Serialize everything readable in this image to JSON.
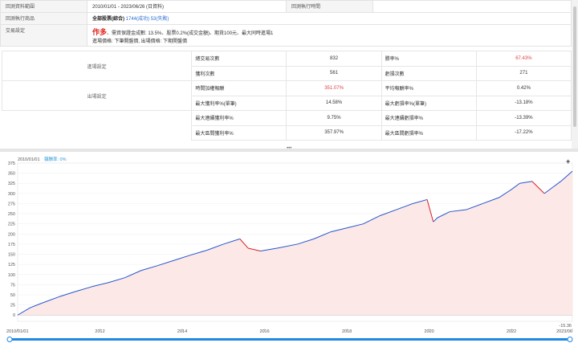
{
  "info": {
    "range_label": "回測資料範圍",
    "range_value": "2010/01/01 - 2023/06/26 (日資料)",
    "exec_time_label": "回測執行時間",
    "exec_time_value": "",
    "products_label": "回測執行商品",
    "products_prefix": "全部股票(綜合)",
    "products_success": "1744(成功)",
    "products_fail": "53(失敗)",
    "trade_label": "交易設定",
    "trade_author": "作多",
    "trade_detail": "、需資保證金成數: 13.5%、股票0.2%(成交金額)、期貨100元、最大同時進場1",
    "trade_detail2": "進場價格: 下筆開盤價, 出場價格: 下期開盤價"
  },
  "stats": {
    "entry_label": "進場設定",
    "exit_label": "出場設定",
    "rows": [
      {
        "l1": "總交易次數",
        "v1": "832",
        "l2": "勝率%",
        "v2": "67.43%",
        "v1red": false,
        "v2red": true
      },
      {
        "l1": "獲利次數",
        "v1": "561",
        "l2": "虧損次數",
        "v2": "271",
        "v1red": false,
        "v2red": false
      },
      {
        "l1": "時間加權報酬",
        "v1": "351.07%",
        "l2": "平均報酬率%",
        "v2": "0.42%",
        "v1red": true,
        "v2red": false
      },
      {
        "l1": "最大獲利率%(單筆)",
        "v1": "14.58%",
        "l2": "最大虧損率%(單筆)",
        "v2": "-13.18%",
        "v1red": false,
        "v2red": false
      },
      {
        "l1": "最大連續獲利率%",
        "v1": "9.75%",
        "l2": "最大連續虧損率%",
        "v2": "-13.39%",
        "v1red": false,
        "v2red": false
      },
      {
        "l1": "最大區間獲利率%",
        "v1": "357.97%",
        "l2": "最大區間虧損率%",
        "v2": "-17.22%",
        "v1red": false,
        "v2red": false
      }
    ]
  },
  "chart_data": {
    "type": "area",
    "title": "",
    "header_date": "2010/01/01",
    "header_metric": "報酬率: 0%",
    "ylim": [
      -15.36,
      375
    ],
    "yticks": [
      0,
      25,
      50,
      75,
      100,
      125,
      150,
      175,
      200,
      225,
      250,
      275,
      300,
      325,
      350,
      375
    ],
    "bottom_value": "-15.36",
    "xlim": [
      2010.0,
      2023.48
    ],
    "xticks": [
      "2010/01/01",
      "2012",
      "2014",
      "2016",
      "2018",
      "2020",
      "2022",
      "2023/06"
    ],
    "xtick_values": [
      2010.0,
      2012,
      2014,
      2016,
      2018,
      2020,
      2022,
      2023.48
    ],
    "series": [
      {
        "x": [
          2010.0,
          2010.3,
          2010.6,
          2011.0,
          2011.4,
          2011.8,
          2012.2,
          2012.6,
          2013.0,
          2013.4,
          2013.8,
          2014.2,
          2014.6,
          2015.0,
          2015.4,
          2015.6,
          2015.9,
          2016.3,
          2016.8,
          2017.2,
          2017.6,
          2018.0,
          2018.4,
          2018.8,
          2019.2,
          2019.6,
          2019.95,
          2020.1,
          2020.2,
          2020.5,
          2020.9,
          2021.3,
          2021.7,
          2022.0,
          2022.2,
          2022.5,
          2022.8,
          2023.0,
          2023.2,
          2023.48
        ],
        "y": [
          0,
          18,
          30,
          45,
          58,
          70,
          80,
          92,
          110,
          122,
          135,
          148,
          160,
          175,
          188,
          165,
          158,
          165,
          175,
          188,
          205,
          215,
          225,
          245,
          260,
          275,
          285,
          230,
          240,
          255,
          260,
          275,
          290,
          310,
          325,
          330,
          300,
          315,
          330,
          355
        ],
        "colors": [
          "#2255cc",
          "#d62222"
        ]
      }
    ],
    "fill_color": "#fde8e8"
  }
}
